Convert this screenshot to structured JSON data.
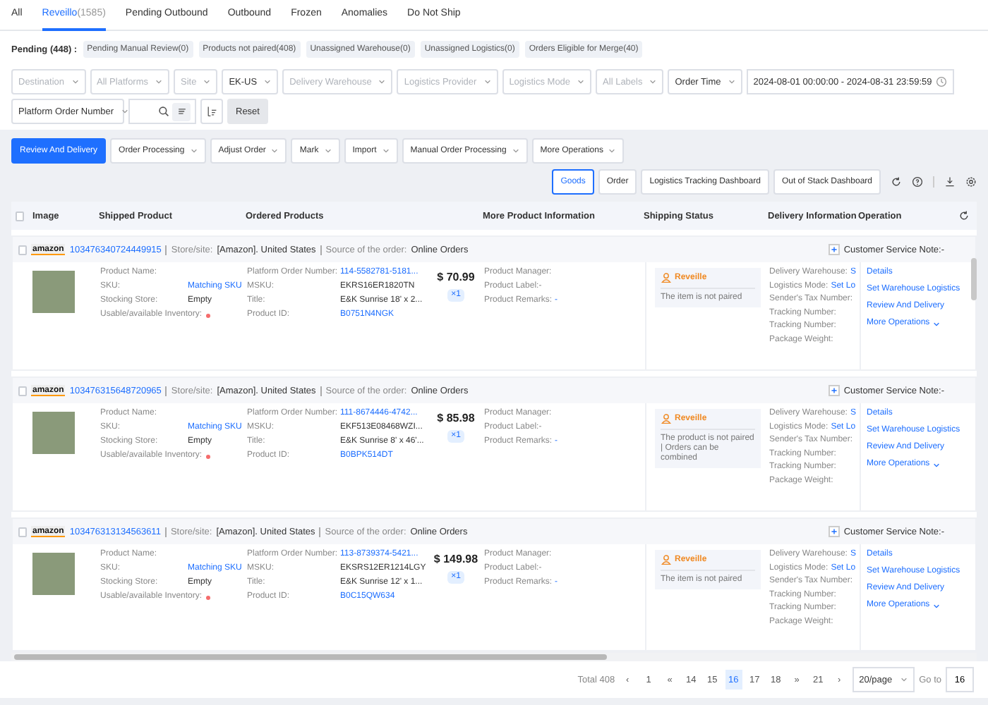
{
  "tabs": [
    {
      "label": "All",
      "selected": false
    },
    {
      "label": "Reveillo",
      "count": "(1585)",
      "selected": true
    },
    {
      "label": "Pending Outbound",
      "selected": false
    },
    {
      "label": "Outbound",
      "selected": false
    },
    {
      "label": "Frozen",
      "selected": false
    },
    {
      "label": "Anomalies",
      "selected": false
    },
    {
      "label": "Do Not Ship",
      "selected": false
    }
  ],
  "pending": {
    "label": "Pending (448) :",
    "chips": [
      "Pending Manual Review(0)",
      "Products not paired(408)",
      "Unassigned Warehouse(0)",
      "Unassigned Logistics(0)",
      "Orders Eligible for Merge(40)"
    ]
  },
  "filters": [
    {
      "kind": "select",
      "placeholder": "Destination"
    },
    {
      "kind": "select",
      "placeholder": "All Platforms"
    },
    {
      "kind": "select",
      "placeholder": "Site"
    },
    {
      "kind": "select",
      "value": "EK-US"
    },
    {
      "kind": "select",
      "placeholder": "Delivery Warehouse"
    },
    {
      "kind": "select",
      "placeholder": "Logistics Provider"
    },
    {
      "kind": "select",
      "placeholder": "Logistics Mode"
    },
    {
      "kind": "select",
      "placeholder": "All Labels"
    },
    {
      "kind": "select",
      "value": "Order Time"
    },
    {
      "kind": "daterange",
      "value": "2024-08-01 00:00:00 - 2024-08-31 23:59:59"
    }
  ],
  "search": {
    "field": "Platform Order Number",
    "reset": "Reset"
  },
  "actions": [
    {
      "label": "Review And Delivery",
      "primary": true,
      "dropdown": false
    },
    {
      "label": "Order Processing",
      "primary": false,
      "dropdown": true
    },
    {
      "label": "Adjust Order",
      "primary": false,
      "dropdown": true
    },
    {
      "label": "Mark",
      "primary": false,
      "dropdown": true
    },
    {
      "label": "Import",
      "primary": false,
      "dropdown": true
    },
    {
      "label": "Manual Order Processing",
      "primary": false,
      "dropdown": true
    },
    {
      "label": "More Operations",
      "primary": false,
      "dropdown": true
    }
  ],
  "view_toggle": [
    {
      "label": "Goods",
      "selected": true
    },
    {
      "label": "Order",
      "selected": false
    }
  ],
  "dashboards": [
    "Logistics Tracking Dashboard",
    "Out of Stack Dashboard"
  ],
  "table": {
    "select_all_checked": false,
    "columns": [
      "Image",
      "Shipped Product",
      "Ordered Products",
      "More Product Information",
      "Shipping Status",
      "Delivery Information",
      "Operation"
    ],
    "orders": [
      {
        "checked": false,
        "store": "amazon",
        "order_id": "103476340724449915",
        "store_label": "Store/site:",
        "store_value": "[Amazon]. United States",
        "source_label": "Source of the order:",
        "source_value": "Online Orders",
        "note": "Customer Service Note:-",
        "product_name": "Product Name:",
        "sku_label": "SKU:",
        "sku": "Matching SKU",
        "stock_label": "Stocking Store:",
        "stock": "Empty",
        "inventory_label": "Usable/available Inventory:",
        "pon_label": "Platform Order Number:",
        "pon": "114-5582781-5181...",
        "msku_label": "MSKU:",
        "msku": "EKRS16ER1820TN",
        "title_label": "Title:",
        "title": "E&K Sunrise 18' x 2...",
        "pid_label": "Product ID:",
        "pid": "B0751N4NGK",
        "price": "$ 70.99",
        "qty": "×1",
        "manager": "Product Manager:",
        "label": "Product Label:-",
        "remarks_label": "Product Remarks:",
        "remarks": "-",
        "status": "Reveille",
        "message": "The item is not paired",
        "delivery": [
          {
            "label": "Delivery Warehouse:",
            "value": "S"
          },
          {
            "label": "Logistics Mode:",
            "value": "Set Lo"
          },
          {
            "label": "Sender's Tax Number:"
          },
          {
            "label": "Tracking Number:"
          },
          {
            "label": "Tracking Number:"
          },
          {
            "label": "Package Weight:"
          }
        ],
        "ops": [
          "Details",
          "Set Warehouse Logistics",
          "Review And Delivery",
          "More Operations"
        ]
      },
      {
        "checked": false,
        "store": "amazon",
        "order_id": "103476315648720965",
        "store_label": "Store/site:",
        "store_value": "[Amazon]. United States",
        "source_label": "Source of the order:",
        "source_value": "Online Orders",
        "note": "Customer Service Note:-",
        "product_name": "Product Name:",
        "sku_label": "SKU:",
        "sku": "Matching SKU",
        "stock_label": "Stocking Store:",
        "stock": "Empty",
        "inventory_label": "Usable/available Inventory:",
        "pon_label": "Platform Order Number:",
        "pon": "111-8674446-4742...",
        "msku_label": "MSKU:",
        "msku": "EKF513E08468WZI...",
        "title_label": "Title:",
        "title": "E&K Sunrise 8' x 46'...",
        "pid_label": "Product ID:",
        "pid": "B0BPK514DT",
        "price": "$ 85.98",
        "qty": "×1",
        "manager": "Product Manager:",
        "label": "Product Label:-",
        "remarks_label": "Product Remarks:",
        "remarks": "-",
        "status": "Reveille",
        "message": "The product is not paired | Orders can be combined",
        "delivery": [
          {
            "label": "Delivery Warehouse:",
            "value": "S"
          },
          {
            "label": "Logistics Mode:",
            "value": "Set Lo"
          },
          {
            "label": "Sender's Tax Number:"
          },
          {
            "label": "Tracking Number:"
          },
          {
            "label": "Tracking Number:"
          },
          {
            "label": "Package Weight:"
          }
        ],
        "ops": [
          "Details",
          "Set Warehouse Logistics",
          "Review And Delivery",
          "More Operations"
        ]
      },
      {
        "checked": false,
        "store": "amazon",
        "order_id": "103476313134563611",
        "store_label": "Store/site:",
        "store_value": "[Amazon]. United States",
        "source_label": "Source of the order:",
        "source_value": "Online Orders",
        "note": "Customer Service Note:-",
        "product_name": "Product Name:",
        "sku_label": "SKU:",
        "sku": "Matching SKU",
        "stock_label": "Stocking Store:",
        "stock": "Empty",
        "inventory_label": "Usable/available Inventory:",
        "pon_label": "Platform Order Number:",
        "pon": "113-8739374-5421...",
        "msku_label": "MSKU:",
        "msku": "EKSRS12ER1214LGY",
        "title_label": "Title:",
        "title": "E&K Sunrise 12' x 1...",
        "pid_label": "Product ID:",
        "pid": "B0C15QW634",
        "price": "$ 149.98",
        "qty": "×1",
        "manager": "Product Manager:",
        "label": "Product Label:-",
        "remarks_label": "Product Remarks:",
        "remarks": "-",
        "status": "Reveille",
        "message": "The item is not paired",
        "delivery": [
          {
            "label": "Delivery Warehouse:",
            "value": "S"
          },
          {
            "label": "Logistics Mode:",
            "value": "Set Lo"
          },
          {
            "label": "Sender's Tax Number:"
          },
          {
            "label": "Tracking Number:"
          },
          {
            "label": "Tracking Number:"
          },
          {
            "label": "Package Weight:"
          }
        ],
        "ops": [
          "Details",
          "Set Warehouse Logistics",
          "Review And Delivery",
          "More Operations"
        ]
      }
    ]
  },
  "pagination": {
    "total": "Total 408",
    "pages": [
      {
        "label": "‹",
        "selected": false
      },
      {
        "label": "1",
        "selected": false
      },
      {
        "label": "«",
        "selected": false
      },
      {
        "label": "14",
        "selected": false
      },
      {
        "label": "15",
        "selected": false
      },
      {
        "label": "16",
        "selected": true
      },
      {
        "label": "17",
        "selected": false
      },
      {
        "label": "18",
        "selected": false
      },
      {
        "label": "»",
        "selected": false
      },
      {
        "label": "21",
        "selected": false
      },
      {
        "label": "›",
        "selected": false
      }
    ],
    "page_size": "20/page",
    "goto_label": "Go to",
    "goto_value": "16"
  }
}
